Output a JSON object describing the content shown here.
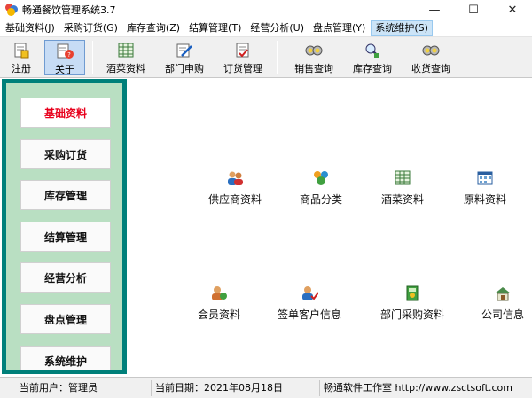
{
  "window": {
    "title": "畅通餐饮管理系统3.7",
    "minimize": "—",
    "maximize": "☐",
    "close": "✕"
  },
  "menubar": [
    {
      "label": "基础资料(J)"
    },
    {
      "label": "采购订货(G)"
    },
    {
      "label": "库存查询(Z)"
    },
    {
      "label": "结算管理(T)"
    },
    {
      "label": "经营分析(U)"
    },
    {
      "label": "盘点管理(Y)"
    },
    {
      "label": "系统维护(S)"
    }
  ],
  "toolbar": [
    {
      "label": "注册",
      "icon": "register-icon"
    },
    {
      "label": "关于",
      "icon": "about-icon"
    },
    {
      "label": "酒菜资料",
      "icon": "dish-data-icon"
    },
    {
      "label": "部门申购",
      "icon": "dept-purchase-icon"
    },
    {
      "label": "订货管理",
      "icon": "order-manage-icon"
    },
    {
      "label": "销售查询",
      "icon": "sales-query-icon"
    },
    {
      "label": "库存查询",
      "icon": "stock-query-icon"
    },
    {
      "label": "收货查询",
      "icon": "receive-query-icon"
    }
  ],
  "sidebar": [
    {
      "label": "基础资料"
    },
    {
      "label": "采购订货"
    },
    {
      "label": "库存管理"
    },
    {
      "label": "结算管理"
    },
    {
      "label": "经营分析"
    },
    {
      "label": "盘点管理"
    },
    {
      "label": "系统维护"
    }
  ],
  "main": [
    {
      "label": "供应商资料",
      "icon": "supplier-icon"
    },
    {
      "label": "商品分类",
      "icon": "category-icon"
    },
    {
      "label": "酒菜资料",
      "icon": "dish-icon"
    },
    {
      "label": "原料资料",
      "icon": "material-icon"
    },
    {
      "label": "会员资料",
      "icon": "member-icon"
    },
    {
      "label": "签单客户信息",
      "icon": "sign-customer-icon"
    },
    {
      "label": "部门采购资料",
      "icon": "dept-purchase-data-icon"
    },
    {
      "label": "公司信息",
      "icon": "company-icon"
    }
  ],
  "status": {
    "user": "当前用户：管理员",
    "date": "当前日期：2021年08月18日",
    "studio": "畅通软件工作室 http://www.zsctsoft.com"
  },
  "colors": {
    "panel_border": "#00807a",
    "panel_bg": "#b9dfc2",
    "active_text": "#e8001c"
  }
}
